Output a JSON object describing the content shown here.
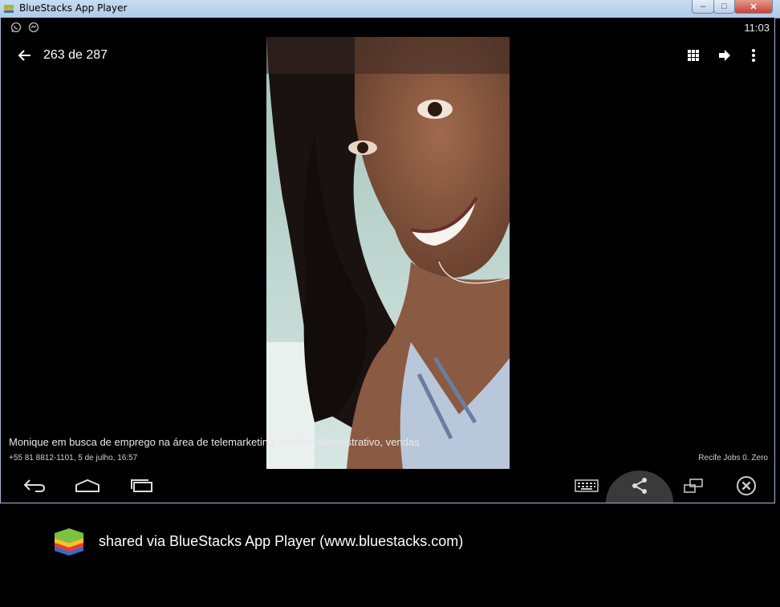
{
  "window": {
    "title": "BlueStacks App Player",
    "controls": {
      "minimize": "–",
      "maximize": "□",
      "close": "✕"
    }
  },
  "statusbar": {
    "icons": [
      "whatsapp-icon",
      "messenger-icon"
    ],
    "time": "11:03"
  },
  "actionbar": {
    "counter": "263 de 287",
    "icons": [
      "back-arrow-icon",
      "grid-icon",
      "forward-share-icon",
      "overflow-menu-icon"
    ]
  },
  "photo": {
    "caption": "Monique em busca de emprego na área de telemarketing, auxiliar administrativo, vendas",
    "sender_info": "+55 81 8812-1101, 5 de julho, 16:57",
    "group_name": "Recife Jobs 0. Zero"
  },
  "navbar": {
    "icons": [
      "back-icon",
      "home-icon",
      "recent-apps-icon",
      "keyboard-icon",
      "share-icon",
      "rotate-icon",
      "close-circle-icon"
    ]
  },
  "footer": {
    "text": "shared via BlueStacks App Player (www.bluestacks.com)"
  },
  "colors": {
    "titlebar": "#b9d1ea",
    "background": "#000000",
    "text": "#ffffff"
  }
}
